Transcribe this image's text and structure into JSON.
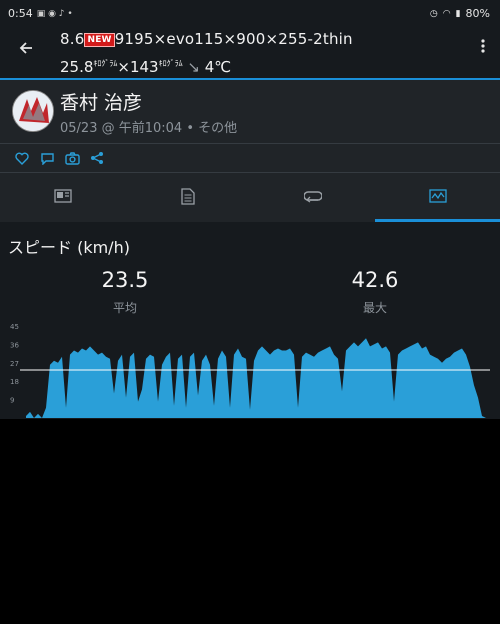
{
  "status_bar": {
    "time": "0:54",
    "battery": "80%"
  },
  "app_bar": {
    "title_part1": "8.6",
    "new_badge": "NEW",
    "title_part2": "9195×evo115×900×255-2thin",
    "subtitle_weight": "25.8",
    "subtitle_unit1": "ｷﾛｸﾞﾗﾑ",
    "subtitle_mid": "×143",
    "subtitle_unit2": "ｷﾛｸﾞﾗﾑ",
    "subtitle_temp": "4℃"
  },
  "activity": {
    "user_name": "香村 治彦",
    "meta": "05/23 @ 午前10:04 • その他"
  },
  "social_icons": [
    "heart-icon",
    "comment-icon",
    "camera-icon",
    "share-icon"
  ],
  "tabs": [
    {
      "name": "tab-overview",
      "icon": "map-card-icon"
    },
    {
      "name": "tab-details",
      "icon": "document-icon"
    },
    {
      "name": "tab-laps",
      "icon": "loop-icon"
    },
    {
      "name": "tab-charts",
      "icon": "chart-icon",
      "active": true
    }
  ],
  "speed_section": {
    "title": "スピード (km/h)",
    "avg_value": "23.5",
    "avg_label": "平均",
    "max_value": "42.6",
    "max_label": "最大"
  },
  "chart_data": {
    "type": "area",
    "title": "スピード (km/h)",
    "xlabel": "",
    "ylabel": "",
    "ylim": [
      0,
      45
    ],
    "yticks": [
      9,
      18,
      27,
      36,
      45
    ],
    "avg_line": 23.5,
    "grid": false,
    "series_color": "#2a9fd8",
    "values": [
      1,
      3,
      0,
      2,
      0,
      5,
      26,
      28,
      27,
      30,
      5,
      31,
      33,
      32,
      34,
      33,
      35,
      33,
      31,
      32,
      30,
      29,
      12,
      28,
      31,
      10,
      30,
      32,
      8,
      14,
      29,
      31,
      30,
      8,
      26,
      30,
      32,
      6,
      29,
      31,
      5,
      30,
      32,
      11,
      28,
      31,
      26,
      6,
      29,
      33,
      30,
      5,
      31,
      34,
      30,
      29,
      4,
      28,
      33,
      35,
      33,
      31,
      33,
      34,
      33,
      33,
      34,
      31,
      5,
      30,
      32,
      31,
      30,
      32,
      33,
      34,
      35,
      31,
      29,
      13,
      33,
      35,
      37,
      35,
      37,
      39,
      35,
      36,
      37,
      34,
      35,
      32,
      8,
      31,
      33,
      34,
      35,
      36,
      37,
      34,
      35,
      31,
      30,
      29,
      27,
      29,
      30,
      32,
      33,
      34,
      31,
      25,
      16,
      10,
      1,
      0
    ]
  }
}
